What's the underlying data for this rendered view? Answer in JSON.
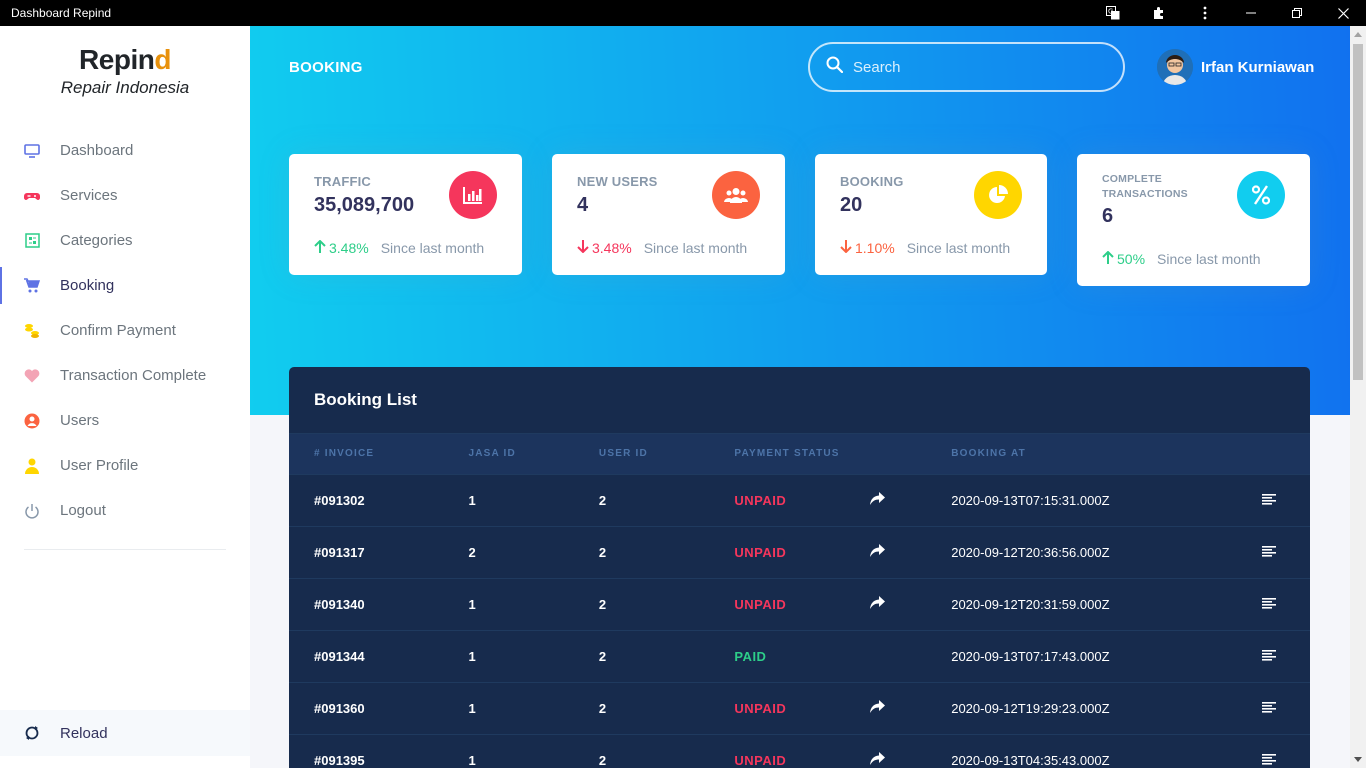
{
  "window": {
    "title": "Dashboard Repind"
  },
  "sidebar": {
    "logo_main": "Repin",
    "logo_accent": "d",
    "tagline": "Repair Indonesia",
    "items": [
      {
        "label": "Dashboard",
        "icon": "monitor-icon",
        "color": "#5e72e4"
      },
      {
        "label": "Services",
        "icon": "gamepad-icon",
        "color": "#f5365c"
      },
      {
        "label": "Categories",
        "icon": "grid-icon",
        "color": "#2dce89"
      },
      {
        "label": "Booking",
        "icon": "cart-icon",
        "color": "#5e72e4",
        "active": true
      },
      {
        "label": "Confirm Payment",
        "icon": "coins-icon",
        "color": "#ffd600"
      },
      {
        "label": "Transaction Complete",
        "icon": "heart-icon",
        "color": "#f3a4b5"
      },
      {
        "label": "Users",
        "icon": "user-circle-icon",
        "color": "#fb6340"
      },
      {
        "label": "User Profile",
        "icon": "user-icon",
        "color": "#ffd600"
      },
      {
        "label": "Logout",
        "icon": "power-icon",
        "color": "#8898aa"
      }
    ],
    "reload_label": "Reload"
  },
  "header": {
    "page_title": "BOOKING",
    "search_placeholder": "Search",
    "user_name": "Irfan Kurniawan"
  },
  "stats": [
    {
      "title": "TRAFFIC",
      "value": "35,089,700",
      "change": "3.48%",
      "direction": "up",
      "since": "Since last month",
      "icon": "chart-bar-icon",
      "color": "#f5365c"
    },
    {
      "title": "NEW USERS",
      "value": "4",
      "change": "3.48%",
      "direction": "down",
      "since": "Since last month",
      "icon": "users-icon",
      "color": "#fb6340"
    },
    {
      "title": "BOOKING",
      "value": "20",
      "change": "1.10%",
      "direction": "down",
      "since": "Since last month",
      "icon": "chart-pie-icon",
      "color": "#ffd600"
    },
    {
      "title": "COMPLETE TRANSACTIONS",
      "value": "6",
      "change": "50%",
      "direction": "up",
      "since": "Since last month",
      "icon": "percent-icon",
      "color": "#11cdef"
    }
  ],
  "table": {
    "title": "Booking List",
    "columns": [
      "# INVOICE",
      "JASA ID",
      "USER ID",
      "PAYMENT STATUS",
      "BOOKING AT"
    ],
    "rows": [
      {
        "invoice": "#091302",
        "jasa_id": "1",
        "user_id": "2",
        "status": "UNPAID",
        "booking_at": "2020-09-13T07:15:31.000Z"
      },
      {
        "invoice": "#091317",
        "jasa_id": "2",
        "user_id": "2",
        "status": "UNPAID",
        "booking_at": "2020-09-12T20:36:56.000Z"
      },
      {
        "invoice": "#091340",
        "jasa_id": "1",
        "user_id": "2",
        "status": "UNPAID",
        "booking_at": "2020-09-12T20:31:59.000Z"
      },
      {
        "invoice": "#091344",
        "jasa_id": "1",
        "user_id": "2",
        "status": "PAID",
        "booking_at": "2020-09-13T07:17:43.000Z"
      },
      {
        "invoice": "#091360",
        "jasa_id": "1",
        "user_id": "2",
        "status": "UNPAID",
        "booking_at": "2020-09-12T19:29:23.000Z"
      },
      {
        "invoice": "#091395",
        "jasa_id": "1",
        "user_id": "2",
        "status": "UNPAID",
        "booking_at": "2020-09-13T04:35:43.000Z"
      }
    ]
  }
}
